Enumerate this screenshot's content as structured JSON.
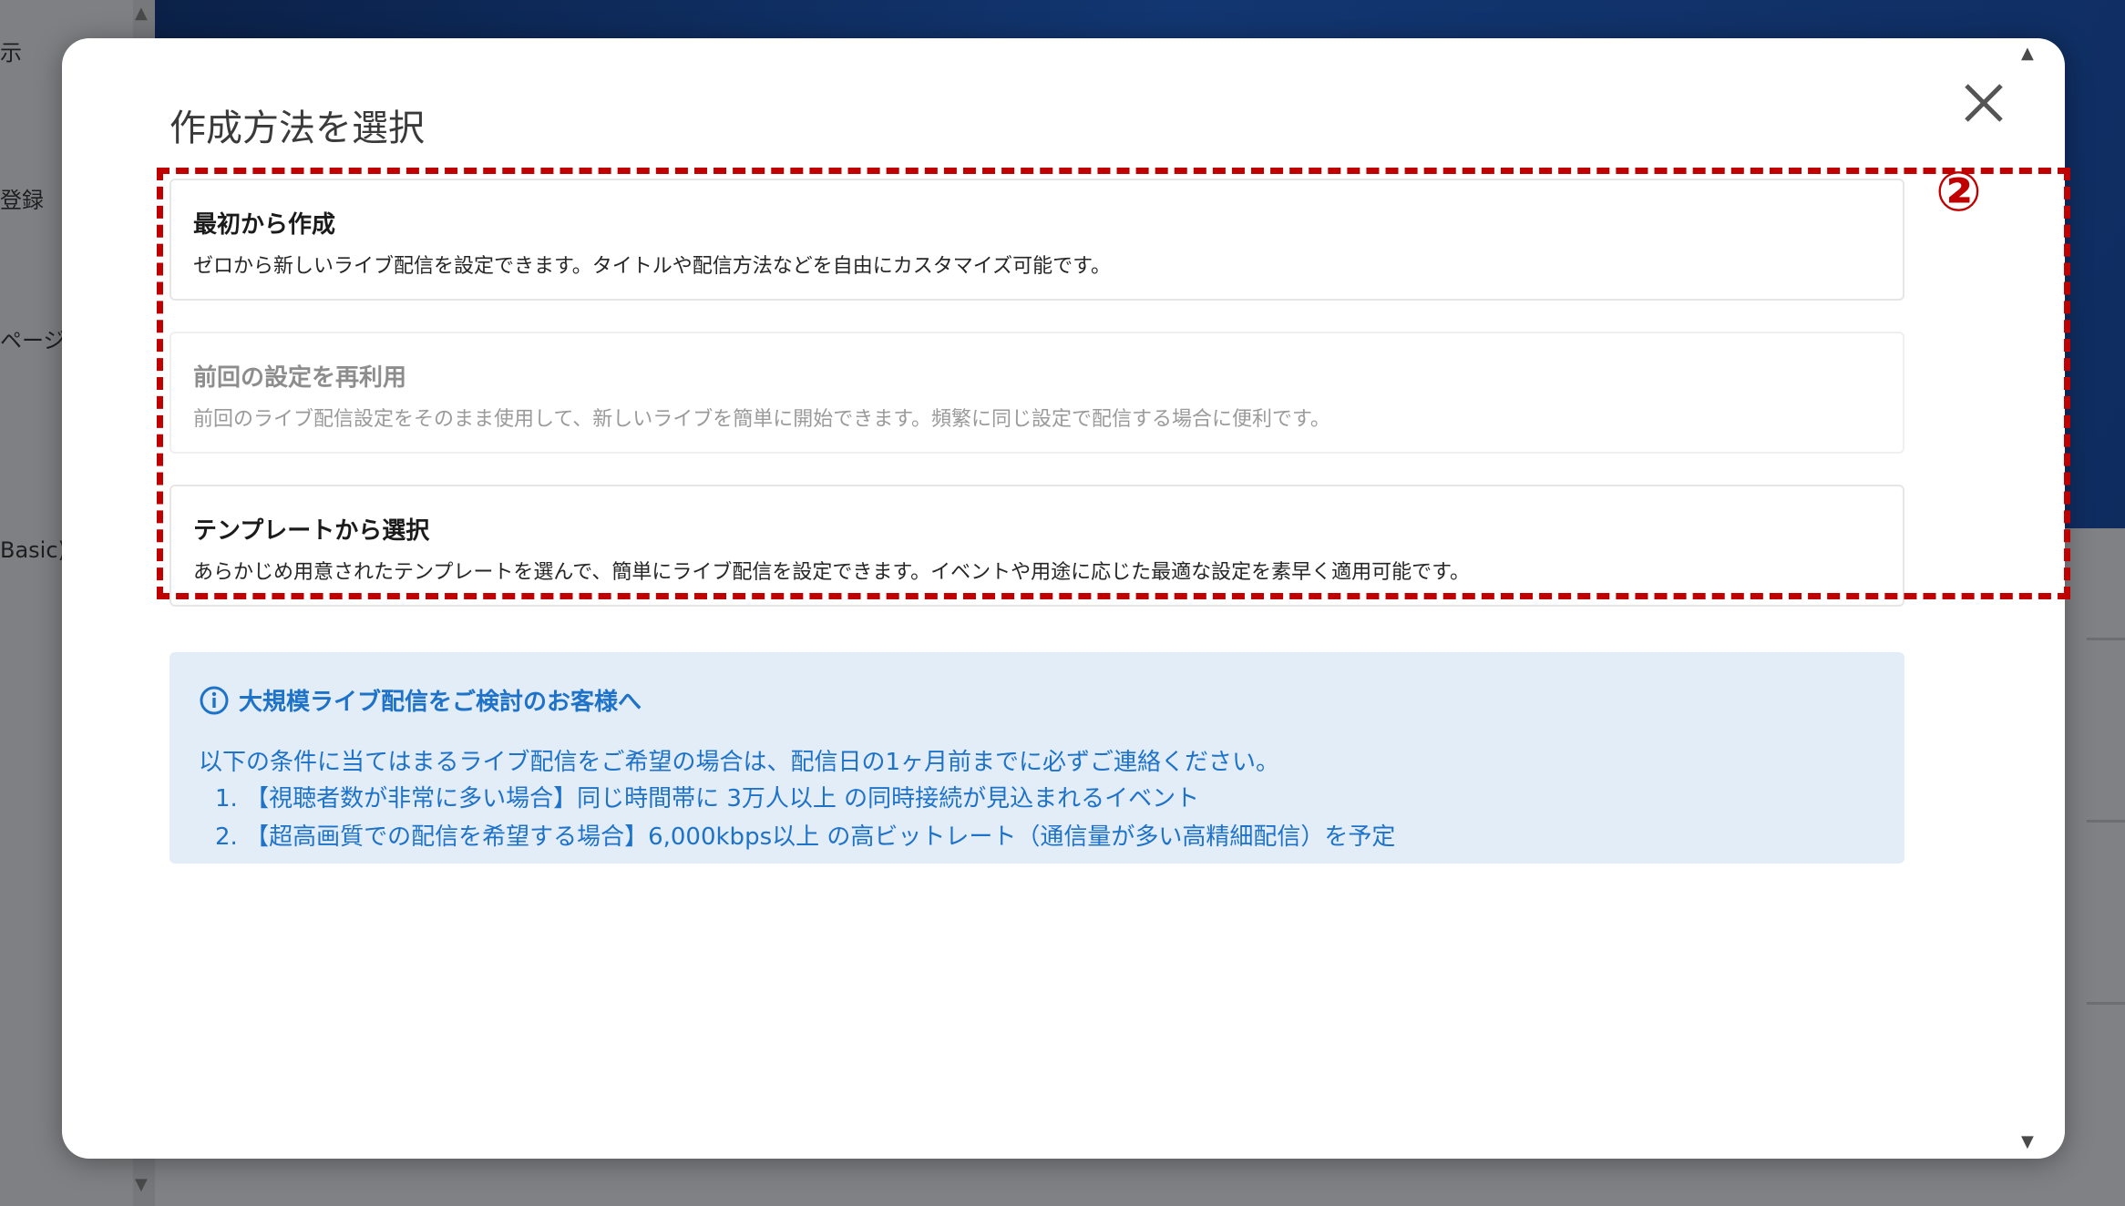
{
  "background": {
    "left_texts": [
      "示",
      "登録",
      "ページ",
      "Basic)"
    ]
  },
  "modal": {
    "title": "作成方法を選択",
    "close_icon": "close-icon",
    "annotation_number": "②",
    "options": [
      {
        "title": "最初から作成",
        "description": "ゼロから新しいライブ配信を設定できます。タイトルや配信方法などを自由にカスタマイズ可能です。",
        "disabled": false
      },
      {
        "title": "前回の設定を再利用",
        "description": "前回のライブ配信設定をそのまま使用して、新しいライブを簡単に開始できます。頻繁に同じ設定で配信する場合に便利です。",
        "disabled": true
      },
      {
        "title": "テンプレートから選択",
        "description": "あらかじめ用意されたテンプレートを選んで、簡単にライブ配信を設定できます。イベントや用途に応じた最適な設定を素早く適用可能です。",
        "disabled": false
      }
    ],
    "info": {
      "icon": "info-icon",
      "title": "大規模ライブ配信をご検討のお客様へ",
      "text": "以下の条件に当てはまるライブ配信をご希望の場合は、配信日の1ヶ月前までに必ずご連絡ください。",
      "items": [
        "1. 【視聴者数が非常に多い場合】同じ時間帯に 3万人以上 の同時接続が見込まれるイベント",
        "2. 【超高画質での配信を希望する場合】6,000kbps以上 の高ビットレート（通信量が多い高精細配信）を予定"
      ]
    }
  },
  "colors": {
    "highlight": "#c00000",
    "info_text": "#1e73c9",
    "info_bg": "#e3edf8"
  }
}
